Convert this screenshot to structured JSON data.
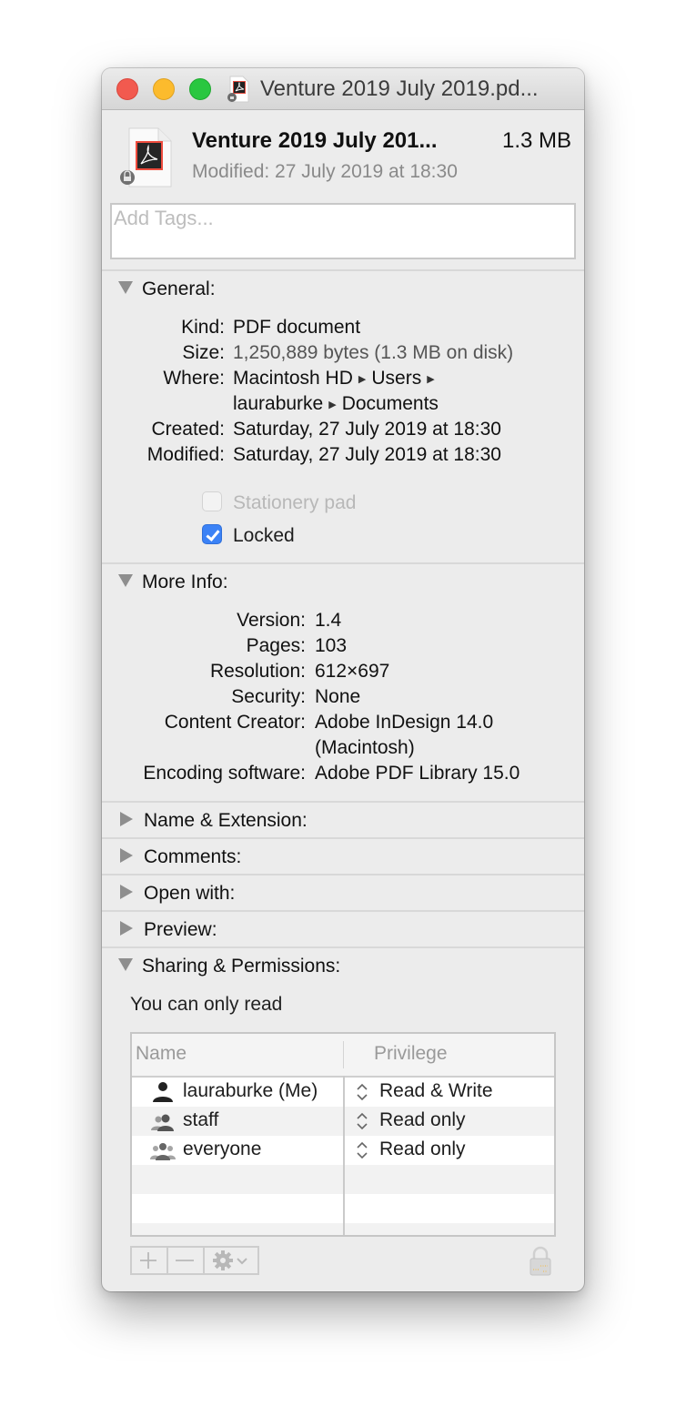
{
  "window": {
    "title": "Venture 2019 July 2019.pd...",
    "traffic_lights": {
      "close": "#f25a4f",
      "minimize": "#fcbb2d",
      "maximize": "#29c740"
    }
  },
  "header": {
    "file_icon": "pdf-document-locked-icon",
    "file_name": "Venture 2019 July 201...",
    "file_size": "1.3 MB",
    "modified": "Modified: 27 July 2019 at 18:30",
    "tags_placeholder": "Add Tags..."
  },
  "general": {
    "title": "General:",
    "expanded": true,
    "rows": [
      {
        "key": "Kind:",
        "value": "PDF document"
      },
      {
        "key": "Size:",
        "value": "1,250,889 bytes (1.3 MB on disk)"
      },
      {
        "key": "Where:",
        "value_parts": [
          "Macintosh HD",
          "Users",
          "lauraburke",
          "Documents"
        ]
      },
      {
        "key": "Created:",
        "value": "Saturday, 27 July 2019 at 18:30"
      },
      {
        "key": "Modified:",
        "value": "Saturday, 27 July 2019 at 18:30"
      }
    ],
    "checkboxes": [
      {
        "label": "Stationery pad",
        "checked": false,
        "enabled": false
      },
      {
        "label": "Locked",
        "checked": true,
        "enabled": true
      }
    ]
  },
  "more_info": {
    "title": "More Info:",
    "expanded": true,
    "rows": [
      {
        "key": "Version:",
        "value": "1.4"
      },
      {
        "key": "Pages:",
        "value": "103"
      },
      {
        "key": "Resolution:",
        "value": "612×697"
      },
      {
        "key": "Security:",
        "value": "None"
      },
      {
        "key": "Content Creator:",
        "value": "Adobe InDesign 14.0",
        "value2": "(Macintosh)"
      },
      {
        "key": "Encoding software:",
        "value": "Adobe PDF Library 15.0"
      }
    ]
  },
  "collapsed_sections": [
    {
      "title": "Name & Extension:"
    },
    {
      "title": "Comments:"
    },
    {
      "title": "Open with:"
    },
    {
      "title": "Preview:"
    }
  ],
  "sharing": {
    "title": "Sharing & Permissions:",
    "expanded": true,
    "note": "You can only read",
    "columns": [
      "Name",
      "Privilege"
    ],
    "rows": [
      {
        "icon": "single-user-icon",
        "name": "lauraburke (Me)",
        "privilege": "Read & Write"
      },
      {
        "icon": "group-icon",
        "name": "staff",
        "privilege": "Read only"
      },
      {
        "icon": "everyone-icon",
        "name": "everyone",
        "privilege": "Read only"
      }
    ],
    "buttons": [
      "add",
      "remove",
      "action-menu"
    ],
    "lock_state": "locked"
  },
  "accent_color": "#3b82f6"
}
